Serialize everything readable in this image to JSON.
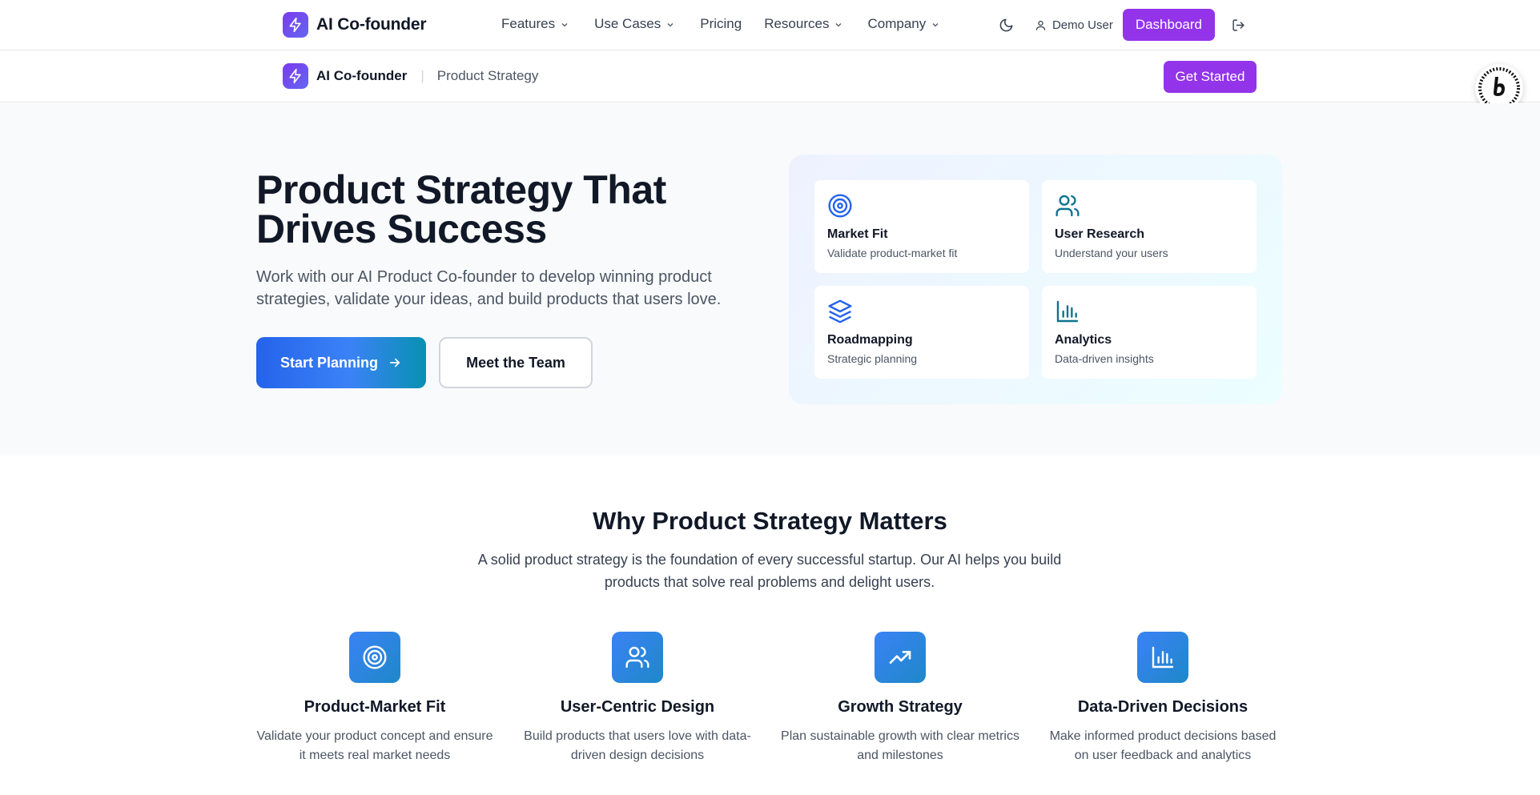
{
  "topnav": {
    "brand": "AI Co-founder",
    "menu": [
      {
        "label": "Features",
        "has_dropdown": true
      },
      {
        "label": "Use Cases",
        "has_dropdown": true
      },
      {
        "label": "Pricing",
        "has_dropdown": false
      },
      {
        "label": "Resources",
        "has_dropdown": true
      },
      {
        "label": "Company",
        "has_dropdown": true
      }
    ],
    "theme_icon": "moon-icon",
    "user_name": "Demo User",
    "dashboard_label": "Dashboard",
    "logout_icon": "logout-icon"
  },
  "subnav": {
    "brand": "AI Co-founder",
    "separator": "|",
    "breadcrumb": "Product Strategy",
    "cta_label": "Get Started"
  },
  "hero": {
    "title_line1": "Product Strategy That",
    "title_line2": "Drives Success",
    "description": "Work with our AI Product Co-founder to develop winning product strategies, validate your ideas, and build products that users love.",
    "primary_cta": "Start Planning",
    "secondary_cta": "Meet the Team",
    "features": [
      {
        "icon": "target-icon",
        "title": "Market Fit",
        "description": "Validate product-market fit"
      },
      {
        "icon": "users-icon",
        "title": "User Research",
        "description": "Understand your users"
      },
      {
        "icon": "layers-icon",
        "title": "Roadmapping",
        "description": "Strategic planning"
      },
      {
        "icon": "bar-chart-icon",
        "title": "Analytics",
        "description": "Data-driven insights"
      }
    ]
  },
  "why": {
    "title": "Why Product Strategy Matters",
    "description": "A solid product strategy is the foundation of every successful startup. Our AI helps you build products that solve real problems and delight users.",
    "pillars": [
      {
        "icon": "target-icon",
        "title": "Product-Market Fit",
        "description": "Validate your product concept and ensure it meets real market needs"
      },
      {
        "icon": "users-icon",
        "title": "User-Centric Design",
        "description": "Build products that users love with data-driven design decisions"
      },
      {
        "icon": "trending-up-icon",
        "title": "Growth Strategy",
        "description": "Plan sustainable growth with clear metrics and milestones"
      },
      {
        "icon": "bar-chart-icon",
        "title": "Data-Driven Decisions",
        "description": "Make informed product decisions based on user feedback and analytics"
      }
    ]
  },
  "badge": {
    "icon": "bolt-badge-icon"
  },
  "colors": {
    "brand_purple": "#9333ea",
    "primary_blue": "#2563eb",
    "accent_cyan": "#0891b2",
    "text_dark": "#111827",
    "hero_bg": "#f9fafb"
  }
}
